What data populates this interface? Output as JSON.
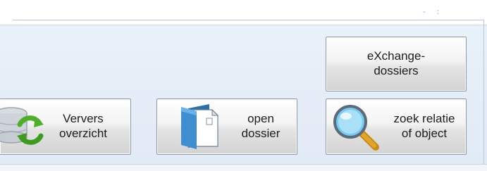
{
  "window": {
    "controls": "- :"
  },
  "toolbar": {
    "exchange_button": {
      "label": "eXchange-\ndossiers"
    },
    "refresh_button": {
      "label": "Ververs\noverzicht",
      "icon": "refresh-icon"
    },
    "open_button": {
      "label": "open\ndossier",
      "icon": "folder-icon"
    },
    "search_button": {
      "label": "zoek relatie\nof object",
      "icon": "magnifier-icon"
    }
  },
  "colors": {
    "panel_background": "#e5edf7",
    "panel_border": "#b7c7d8",
    "refresh_arrows": "#4fae2a",
    "folder_blue": "#3f8fd0",
    "magnifier_lens": "#79c9f0",
    "magnifier_handle": "#e0a52b"
  }
}
